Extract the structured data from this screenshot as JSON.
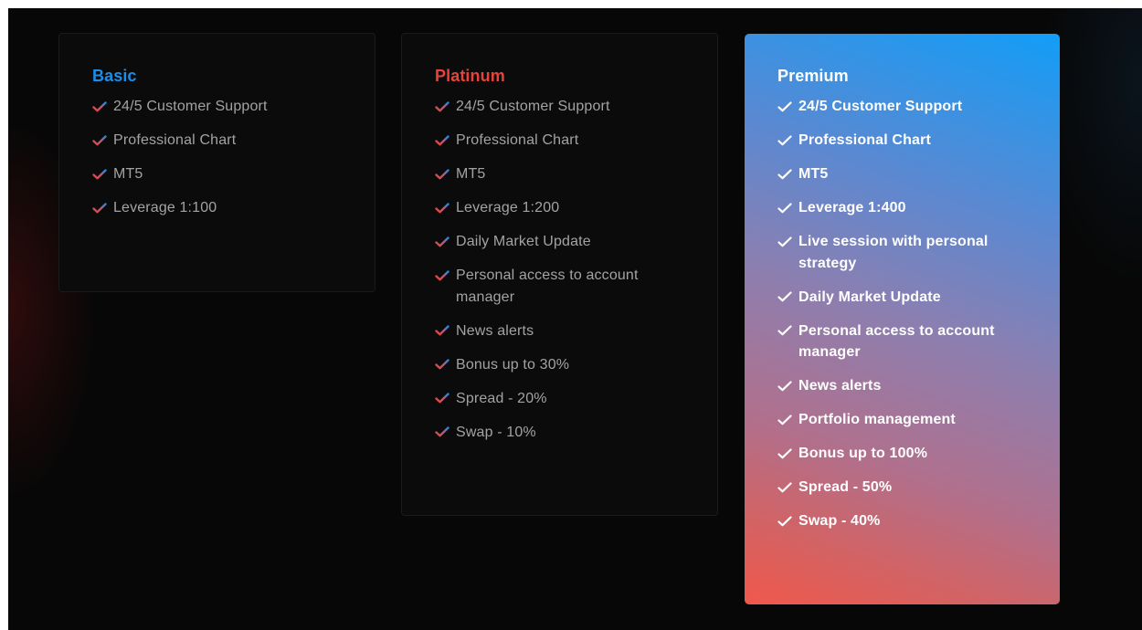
{
  "colors": {
    "background": "#070707",
    "basic_accent": "#1a8ee8",
    "platinum_accent": "#e8433a",
    "premium_gradient_top": "#129df7",
    "premium_gradient_bottom": "#f0584c",
    "feature_text": "#a3a3a3"
  },
  "plans": [
    {
      "title": "Basic",
      "check_icon": "check-icon",
      "features": [
        "24/5 Customer Support",
        "Professional Chart",
        "MT5",
        "Leverage 1:100"
      ]
    },
    {
      "title": "Platinum",
      "check_icon": "check-icon",
      "features": [
        "24/5 Customer Support",
        "Professional Chart",
        "MT5",
        "Leverage 1:200",
        "Daily Market Update",
        "Personal access to account manager",
        "News alerts",
        "Bonus up to 30%",
        "Spread - 20%",
        "Swap - 10%"
      ]
    },
    {
      "title": "Premium",
      "check_icon": "check-icon",
      "features": [
        "24/5 Customer Support",
        "Professional Chart",
        "MT5",
        "Leverage 1:400",
        "Live session with personal strategy",
        "Daily Market Update",
        "Personal access to account manager",
        "News alerts",
        "Portfolio management",
        "Bonus up to 100%",
        "Spread - 50%",
        "Swap - 40%"
      ]
    }
  ]
}
